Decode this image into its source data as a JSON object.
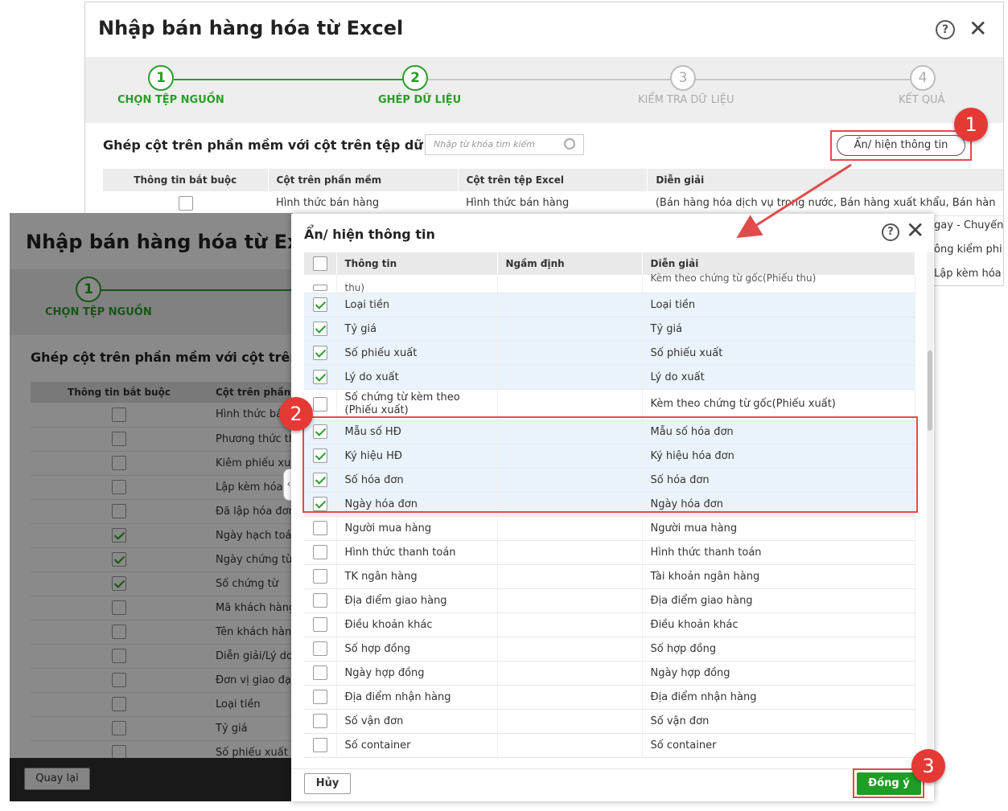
{
  "window_back": {
    "title": "Nhập bán hàng hóa từ Excel",
    "steps": [
      {
        "num": "1",
        "label": "CHỌN TỆP NGUỒN"
      },
      {
        "num": "2",
        "label": "GHÉP DỮ LIỆU"
      },
      {
        "num": "3",
        "label": "KIỂM TRA DỮ LIỆU"
      },
      {
        "num": "4",
        "label": "KẾT QUẢ"
      }
    ],
    "section_title": "Ghép cột trên phần mềm với cột trên tệp dữ liệu",
    "search_placeholder": "Nhập từ khóa tìm kiếm",
    "toggle_button": "Ẩn/ hiện thông tin",
    "columns": [
      "Thông tin bắt buộc",
      "Cột trên phần mềm",
      "Cột trên tệp Excel",
      "Diễn giải"
    ],
    "row1": {
      "software": "Hình thức bán hàng",
      "excel": "Hình thức bán hàng",
      "desc": "(Bán hàng hóa dịch vụ trong nước, Bán hàng xuất khẩu, Bán hàn"
    },
    "right_fragments": [
      "gay - Chuyển",
      "ông kiểm phi",
      "Lập kèm hóa"
    ]
  },
  "window_left": {
    "title": "Nhập bán hàng hóa từ Excel",
    "step1_num": "1",
    "step1_label": "CHỌN TỆP NGUỒN",
    "section_title": "Ghép cột trên phần mềm với cột trên tệp dữ liệu",
    "col_required": "Thông tin bắt buộc",
    "col_software": "Cột trên phần mềm",
    "rows": [
      {
        "label": "Hình thức bán hàng",
        "checked": false
      },
      {
        "label": "Phương thức thanh toán",
        "checked": false
      },
      {
        "label": "Kiêm phiếu xuất",
        "checked": false
      },
      {
        "label": "Lập kèm hóa đơn",
        "checked": false
      },
      {
        "label": "Đã lập hóa đơn",
        "checked": false
      },
      {
        "label": "Ngày hạch toán",
        "checked": true
      },
      {
        "label": "Ngày chứng từ",
        "checked": true
      },
      {
        "label": "Số chứng từ",
        "checked": true
      },
      {
        "label": "Mã khách hàng",
        "checked": false
      },
      {
        "label": "Tên khách hàng",
        "checked": false
      },
      {
        "label": "Diễn giải/Lý do",
        "checked": false
      },
      {
        "label": "Đơn vị giao đại lý",
        "checked": false
      },
      {
        "label": "Loại tiền",
        "checked": false
      },
      {
        "label": "Tỷ giá",
        "checked": false
      },
      {
        "label": "Số phiếu xuất",
        "checked": false
      }
    ],
    "back_button": "Quay lại"
  },
  "dialog": {
    "title": "Ẩn/ hiện thông tin",
    "columns": [
      "Thông tin",
      "Ngầm định",
      "Diễn giải"
    ],
    "partial_row": {
      "info": "thu)",
      "desc": "Kèm theo chứng từ gốc(Phiếu thu)"
    },
    "rows": [
      {
        "info": "Loại tiền",
        "default": "",
        "desc": "Loại tiền",
        "checked": true
      },
      {
        "info": "Tỷ giá",
        "default": "",
        "desc": "Tỷ giá",
        "checked": true
      },
      {
        "info": "Số phiếu xuất",
        "default": "",
        "desc": "Số phiếu xuất",
        "checked": true
      },
      {
        "info": "Lý do xuất",
        "default": "",
        "desc": "Lý do xuất",
        "checked": true
      },
      {
        "info": "Số chứng từ kèm theo (Phiếu xuất)",
        "default": "",
        "desc": "Kèm theo chứng từ gốc(Phiếu xuất)",
        "checked": false
      },
      {
        "info": "Mẫu số HĐ",
        "default": "",
        "desc": "Mẫu số hóa đơn",
        "checked": true
      },
      {
        "info": "Ký hiệu HĐ",
        "default": "",
        "desc": "Ký hiệu hóa đơn",
        "checked": true
      },
      {
        "info": "Số hóa đơn",
        "default": "",
        "desc": "Số hóa đơn",
        "checked": true
      },
      {
        "info": "Ngày hóa đơn",
        "default": "",
        "desc": "Ngày hóa đơn",
        "checked": true
      },
      {
        "info": "Người mua hàng",
        "default": "",
        "desc": "Người mua hàng",
        "checked": false
      },
      {
        "info": "Hình thức thanh toán",
        "default": "",
        "desc": "Hình thức thanh toán",
        "checked": false
      },
      {
        "info": "TK ngân hàng",
        "default": "",
        "desc": "Tài khoản ngân hàng",
        "checked": false
      },
      {
        "info": "Địa điểm giao hàng",
        "default": "",
        "desc": "Địa điểm giao hàng",
        "checked": false
      },
      {
        "info": "Điều khoản khác",
        "default": "",
        "desc": "Điều khoản khác",
        "checked": false
      },
      {
        "info": "Số hợp đồng",
        "default": "",
        "desc": "Số hợp đồng",
        "checked": false
      },
      {
        "info": "Ngày hợp đồng",
        "default": "",
        "desc": "Ngày hợp đồng",
        "checked": false
      },
      {
        "info": "Địa điểm nhận hàng",
        "default": "",
        "desc": "Địa điểm nhận hàng",
        "checked": false
      },
      {
        "info": "Số vận đơn",
        "default": "",
        "desc": "Số vận đơn",
        "checked": false
      },
      {
        "info": "Số container",
        "default": "",
        "desc": "Số container",
        "checked": false
      }
    ],
    "cancel_button": "Hủy",
    "ok_button": "Đồng ý"
  },
  "callouts": [
    "1",
    "2",
    "3"
  ],
  "colors": {
    "accent_green": "#2a9d2a",
    "ok_green": "#1f9d24",
    "callout_red": "#e53935",
    "highlight_red": "#e24b4b",
    "selected_row": "#eaf3fb"
  }
}
